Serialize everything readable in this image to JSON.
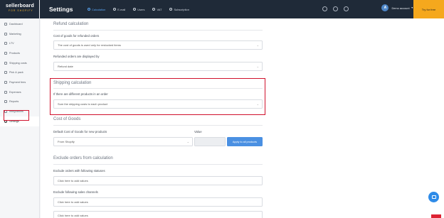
{
  "logo": {
    "main": "sellerboard",
    "sub": "FOR SHOPIFY"
  },
  "sidebar": {
    "items": [
      {
        "label": "Dashboard",
        "icon": "dashboard-icon"
      },
      {
        "label": "Marketing",
        "icon": "megaphone-icon"
      },
      {
        "label": "LTV",
        "icon": "chart-icon"
      },
      {
        "label": "Products",
        "icon": "box-icon"
      },
      {
        "label": "Shipping costs",
        "icon": "truck-icon"
      },
      {
        "label": "Pick & pack",
        "icon": "package-icon"
      },
      {
        "label": "Payment fees",
        "icon": "card-icon"
      },
      {
        "label": "Expenses",
        "icon": "wallet-icon"
      },
      {
        "label": "Reports",
        "icon": "report-icon"
      },
      {
        "label": "Integrations",
        "icon": "plug-icon"
      },
      {
        "label": "Settings",
        "icon": "gear-icon",
        "active": true
      }
    ]
  },
  "topbar": {
    "title": "Settings",
    "tabs": [
      {
        "label": "Calculation",
        "active": true
      },
      {
        "label": "E-mail"
      },
      {
        "label": "Users"
      },
      {
        "label": "VAT"
      },
      {
        "label": "Subscription"
      }
    ],
    "account": {
      "initial": "A",
      "name": "Demo account"
    },
    "try_button": "Try for free"
  },
  "refund": {
    "title": "Refund calculation",
    "cogs_label": "Cost of goods for refunded orders",
    "cogs_value": "The cost of goods is used only for restocked items",
    "display_label": "Refunded orders are displayed by",
    "display_value": "Refund date"
  },
  "shipping": {
    "title": "Shipping calculation",
    "label": "If there are different products in an order",
    "value": "Sum the shipping costs to each product"
  },
  "cog": {
    "title": "Cost of Goods",
    "default_label": "Default Cost of Goods for new products",
    "default_value": "From Shopify",
    "value_label": "Value",
    "apply_button": "Apply to all products"
  },
  "exclude": {
    "title": "Exclude orders from calculation",
    "statuses_label": "Exclude orders with following statuses",
    "statuses_placeholder": "Click here to add values",
    "channels_label": "Exclude following sales channels",
    "channels_placeholder": "Click here to add values",
    "third_placeholder": "Click here to add values"
  },
  "colors": {
    "topbar": "#1f2a38",
    "accent": "#4a90e2",
    "try_button": "#f5a81d",
    "highlight": "#d0112c"
  }
}
